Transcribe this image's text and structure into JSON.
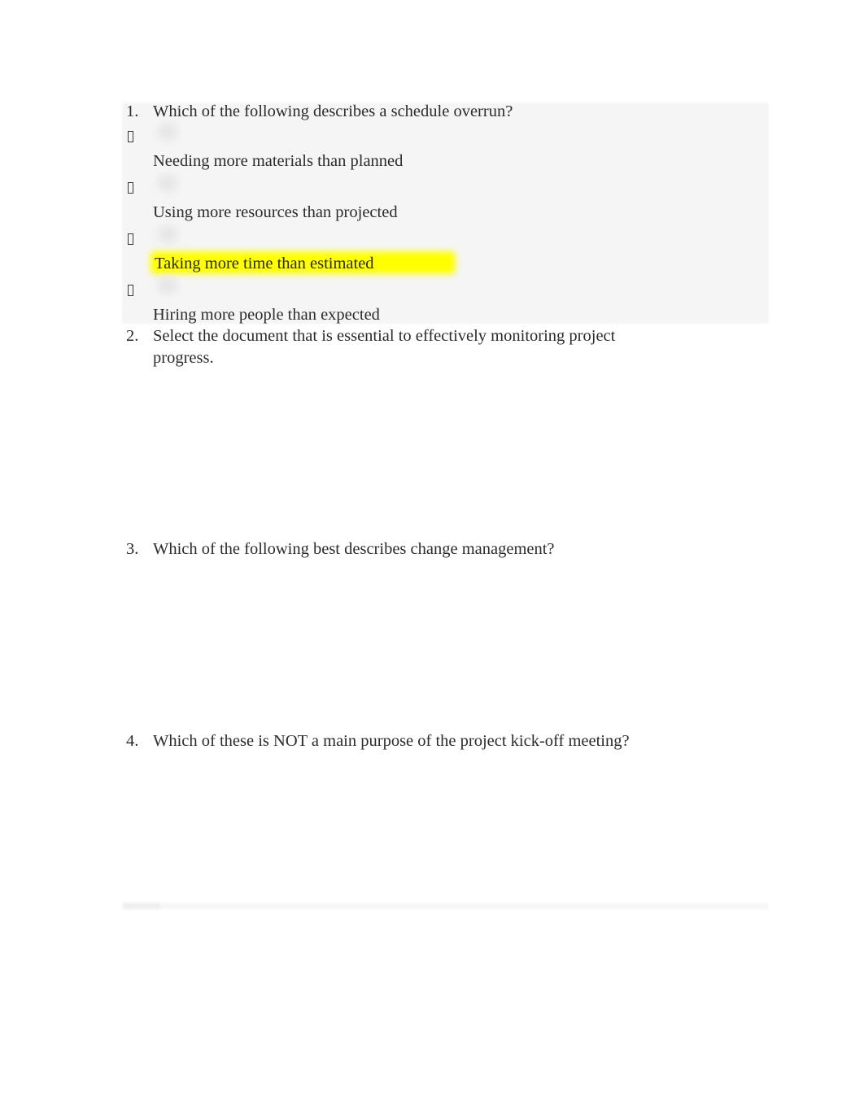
{
  "document": {
    "background_color": "#ffffff",
    "text_color": "#2b2b2b",
    "highlight_color": "#ffff00",
    "shade_color": "#f5f5f5"
  },
  "questions": [
    {
      "number": "1.",
      "text": "Which of the following describes a schedule overrun?",
      "options": [
        {
          "marker": "\u0011",
          "text": "Needing more materials than planned",
          "highlighted": false
        },
        {
          "marker": "\u0011",
          "text": "Using more resources than projected",
          "highlighted": false
        },
        {
          "marker": "\u0011",
          "text": "Taking more time than estimated",
          "highlighted": true
        },
        {
          "marker": "\u0011",
          "text": "Hiring more people than expected",
          "highlighted": false
        }
      ]
    },
    {
      "number": "2.",
      "text": "Select the document that is essential to effectively monitoring project progress.",
      "options": []
    },
    {
      "number": "3.",
      "text": "Which of the following best describes change management?",
      "options": []
    },
    {
      "number": "4.",
      "text": "Which of these is NOT a main purpose of the project kick-off meeting?",
      "options": []
    }
  ]
}
